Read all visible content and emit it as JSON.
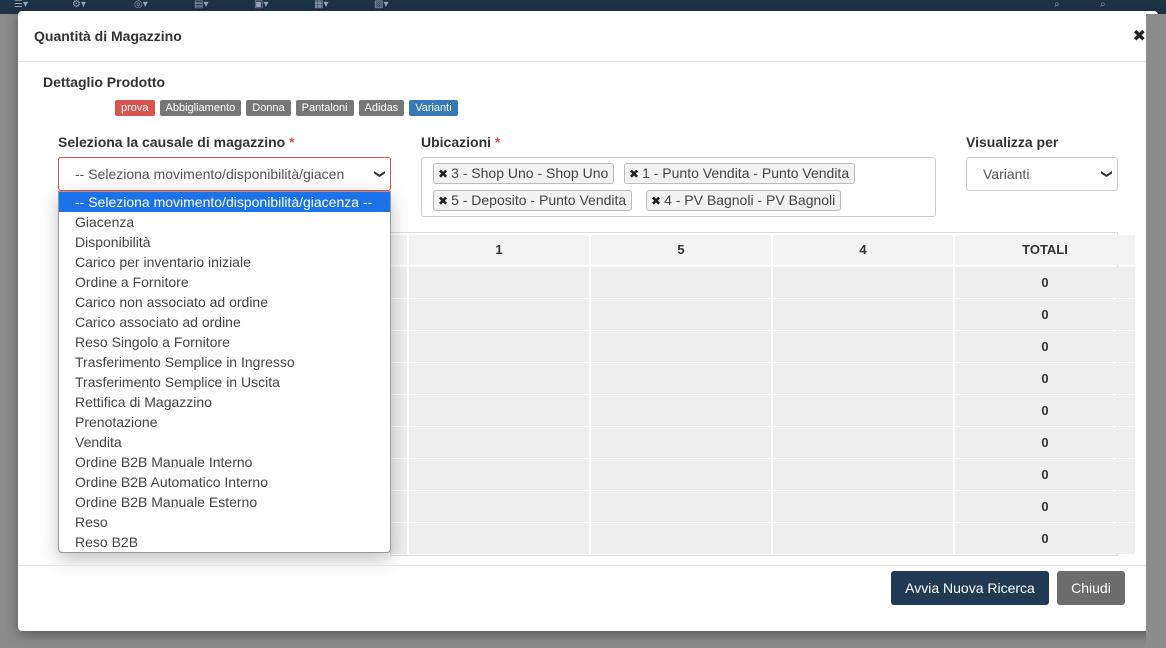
{
  "modal": {
    "title": "Quantità di Magazzino",
    "close_icon": "close-icon"
  },
  "product": {
    "section_title": "Dettaglio Prodotto",
    "tags": [
      {
        "label": "prova",
        "color": "#d9534f"
      },
      {
        "label": "Abbigliamento",
        "color": "#777777"
      },
      {
        "label": "Donna",
        "color": "#777777"
      },
      {
        "label": "Pantaloni",
        "color": "#777777"
      },
      {
        "label": "Adidas",
        "color": "#777777"
      },
      {
        "label": "Varianti",
        "color": "#337ab7"
      }
    ]
  },
  "causale": {
    "label": "Seleziona la causale di magazzino",
    "required_mark": "*",
    "selected": "-- Seleziona movimento/disponibilità/giacen",
    "options": [
      "-- Seleziona movimento/disponibilità/giacenza --",
      "Giacenza",
      "Disponibilità",
      "Carico per inventario iniziale",
      "Ordine a Fornitore",
      "Carico non associato ad ordine",
      "Carico associato ad ordine",
      "Reso Singolo a Fornitore",
      "Trasferimento Semplice in Ingresso",
      "Trasferimento Semplice in Uscita",
      "Rettifica di Magazzino",
      "Prenotazione",
      "Vendita",
      "Ordine B2B Manuale Interno",
      "Ordine B2B Automatico Interno",
      "Ordine B2B Manuale Esterno",
      "Reso",
      "Reso B2B"
    ]
  },
  "ubicazioni": {
    "label": "Ubicazioni",
    "required_mark": "*",
    "chips": [
      "3 - Shop Uno - Shop Uno",
      "1 - Punto Vendita - Punto Vendita",
      "5 - Deposito - Punto Vendita",
      "4 - PV Bagnoli - PV Bagnoli"
    ],
    "remove_glyph": "✖"
  },
  "visualizza": {
    "label": "Visualizza per",
    "selected": "Varianti"
  },
  "table": {
    "headers": [
      "1",
      "5",
      "4",
      "TOTALI"
    ],
    "totals": [
      "0",
      "0",
      "0",
      "0",
      "0",
      "0",
      "0",
      "0",
      "0"
    ]
  },
  "footer": {
    "primary_label": "Avvia Nuova Ricerca",
    "close_label": "Chiudi"
  },
  "colors": {
    "primary": "#203a53",
    "danger": "#d9534f",
    "select_highlight": "#1a73e8"
  }
}
